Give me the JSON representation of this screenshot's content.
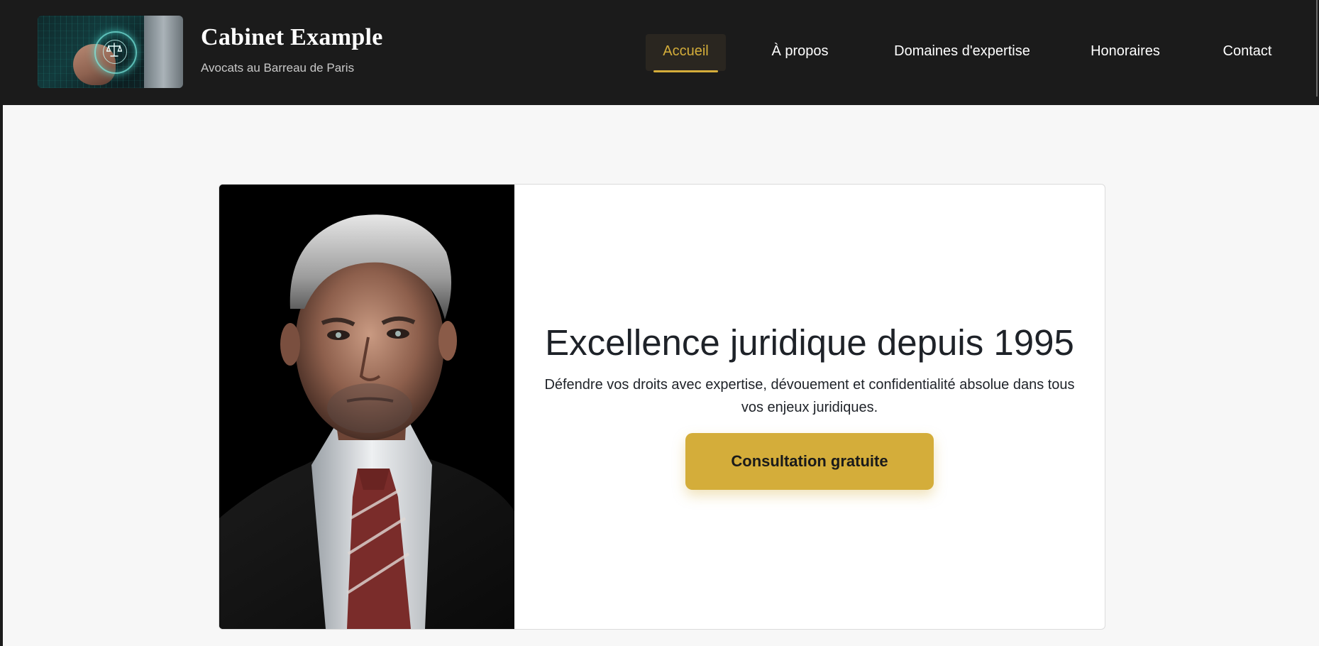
{
  "header": {
    "brand_title": "Cabinet Example",
    "brand_subtitle": "Avocats au Barreau de Paris",
    "logo_icon": "scales-of-justice-icon"
  },
  "nav": {
    "items": [
      {
        "label": "Accueil",
        "active": true
      },
      {
        "label": "À propos",
        "active": false
      },
      {
        "label": "Domaines d'expertise",
        "active": false
      },
      {
        "label": "Honoraires",
        "active": false
      },
      {
        "label": "Contact",
        "active": false
      }
    ]
  },
  "hero": {
    "title": "Excellence juridique depuis 1995",
    "text": "Défendre vos droits avec expertise, dévouement et confidentialité absolue dans tous vos enjeux juridiques.",
    "cta_label": "Consultation gratuite",
    "portrait_alt": "Portrait of a man in a suit and tie"
  },
  "colors": {
    "accent": "#d4ad3a",
    "header_bg": "#1b1b1b",
    "page_bg": "#f7f7f7",
    "text_dark": "#1e2228"
  }
}
